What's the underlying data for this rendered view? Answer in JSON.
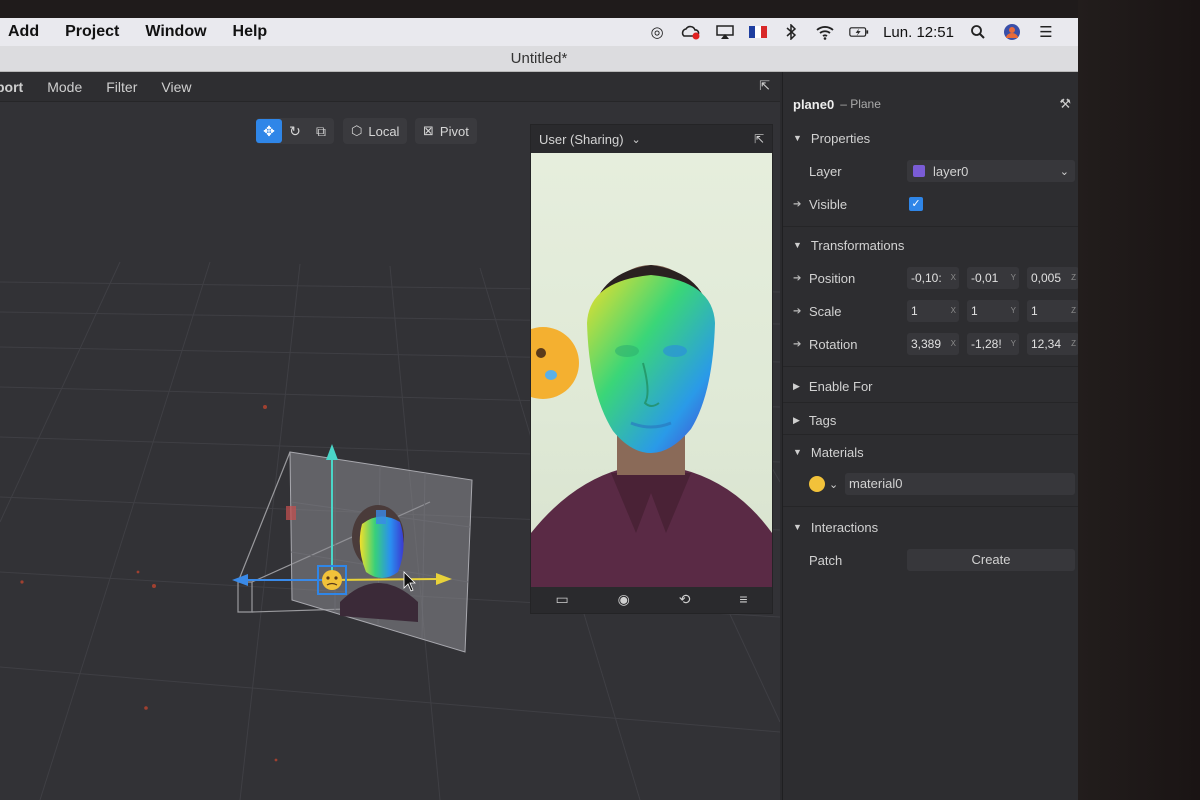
{
  "menubar": {
    "menus": [
      "Add",
      "Project",
      "Window",
      "Help"
    ],
    "clock": "Lun. 12:51",
    "status_icons": [
      "target-icon",
      "creative-cloud-icon",
      "airplay-icon",
      "french-flag-icon",
      "bluetooth-icon",
      "wifi-icon",
      "battery-charging-icon",
      "search-icon",
      "user-avatar-icon",
      "list-icon"
    ]
  },
  "window": {
    "title": "Untitled*"
  },
  "viewport": {
    "tabs": [
      "port",
      "Mode",
      "Filter",
      "View"
    ],
    "tools": {
      "local_label": "Local",
      "pivot_label": "Pivot"
    }
  },
  "simulator": {
    "device_label": "User (Sharing)"
  },
  "inspector": {
    "object_name": "plane0",
    "object_type": "– Plane",
    "sections": {
      "properties": "Properties",
      "transformations": "Transformations",
      "enable_for": "Enable For",
      "tags": "Tags",
      "materials": "Materials",
      "interactions": "Interactions"
    },
    "layer": {
      "label": "Layer",
      "value": "layer0",
      "color": "#7a5cd6"
    },
    "visible": {
      "label": "Visible",
      "checked": true
    },
    "position": {
      "label": "Position",
      "x": "-0,10:",
      "y": "-0,01",
      "z": "0,005"
    },
    "scale": {
      "label": "Scale",
      "x": "1",
      "y": "1",
      "z": "1"
    },
    "rotation": {
      "label": "Rotation",
      "x": "3,389",
      "y": "-1,28!",
      "z": "12,34"
    },
    "axes": {
      "x": "X",
      "y": "Y",
      "z": "Z"
    },
    "material": {
      "name": "material0"
    },
    "patch": {
      "label": "Patch",
      "button": "Create"
    }
  },
  "colors": {
    "accent": "#2f86e8",
    "panel": "#2d2d30",
    "viewport": "#323236"
  }
}
